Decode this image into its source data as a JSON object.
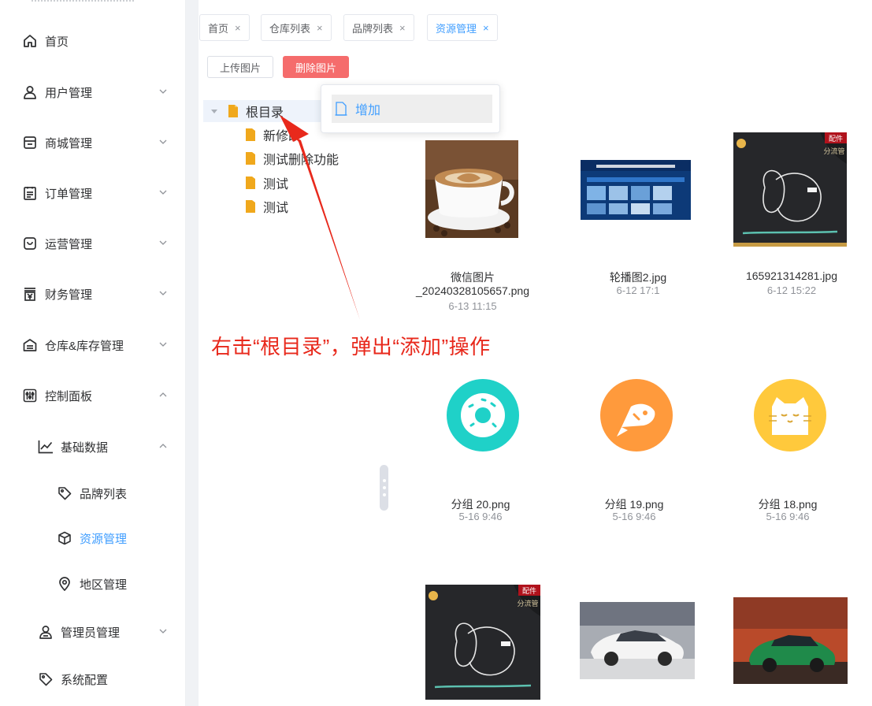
{
  "sidebar": {
    "items": [
      {
        "label": "首页",
        "icon": "home-icon"
      },
      {
        "label": "用户管理",
        "icon": "user-icon"
      },
      {
        "label": "商城管理",
        "icon": "shop-icon"
      },
      {
        "label": "订单管理",
        "icon": "order-icon"
      },
      {
        "label": "运营管理",
        "icon": "operation-icon"
      },
      {
        "label": "财务管理",
        "icon": "finance-icon"
      },
      {
        "label": "仓库&库存管理",
        "icon": "warehouse-icon"
      },
      {
        "label": "控制面板",
        "icon": "control-panel-icon"
      },
      {
        "label": "基础数据",
        "icon": "chart-icon"
      },
      {
        "label": "品牌列表",
        "icon": "tag-icon"
      },
      {
        "label": "资源管理",
        "icon": "cube-icon"
      },
      {
        "label": "地区管理",
        "icon": "location-icon"
      },
      {
        "label": "管理员管理",
        "icon": "admin-icon"
      },
      {
        "label": "系统配置",
        "icon": "tag-icon"
      }
    ]
  },
  "tabs": [
    {
      "label": "首页",
      "close": "×"
    },
    {
      "label": "仓库列表",
      "close": "×"
    },
    {
      "label": "品牌列表",
      "close": "×"
    },
    {
      "label": "资源管理",
      "close": "×"
    }
  ],
  "toolbar": {
    "upload_label": "上传图片",
    "delete_label": "删除图片"
  },
  "tree": {
    "root": "根目录",
    "children": [
      "新修改",
      "测试删除功能",
      "测试",
      "测试"
    ]
  },
  "context_menu": {
    "add_label": "增加"
  },
  "annotation": "右击“根目录”，弹出“添加”操作",
  "images": [
    {
      "name_line1": "微信图片",
      "name_line2": "_20240328105657.png",
      "date": "6-13 11:15"
    },
    {
      "name_line1": "轮播图2.jpg",
      "name_line2": "",
      "date": "6-12 17:1"
    },
    {
      "name_line1": "165921314281.jpg",
      "name_line2": "",
      "date": "6-12 15:22"
    },
    {
      "name_line1": "分组 20.png",
      "name_line2": "",
      "date": "5-16 9:46"
    },
    {
      "name_line1": "分组 19.png",
      "name_line2": "",
      "date": "5-16 9:46"
    },
    {
      "name_line1": "分组 18.png",
      "name_line2": "",
      "date": "5-16 9:46"
    }
  ],
  "product_badge": {
    "line1": "配件",
    "line2": "分流管"
  },
  "colors": {
    "accent": "#409eff",
    "danger": "#f56c6c",
    "annotation": "#e8291c",
    "folder": "#f0a81c",
    "donut": "#1fd1c8",
    "fish": "#ff9a3c",
    "cat": "#ffc93c"
  }
}
